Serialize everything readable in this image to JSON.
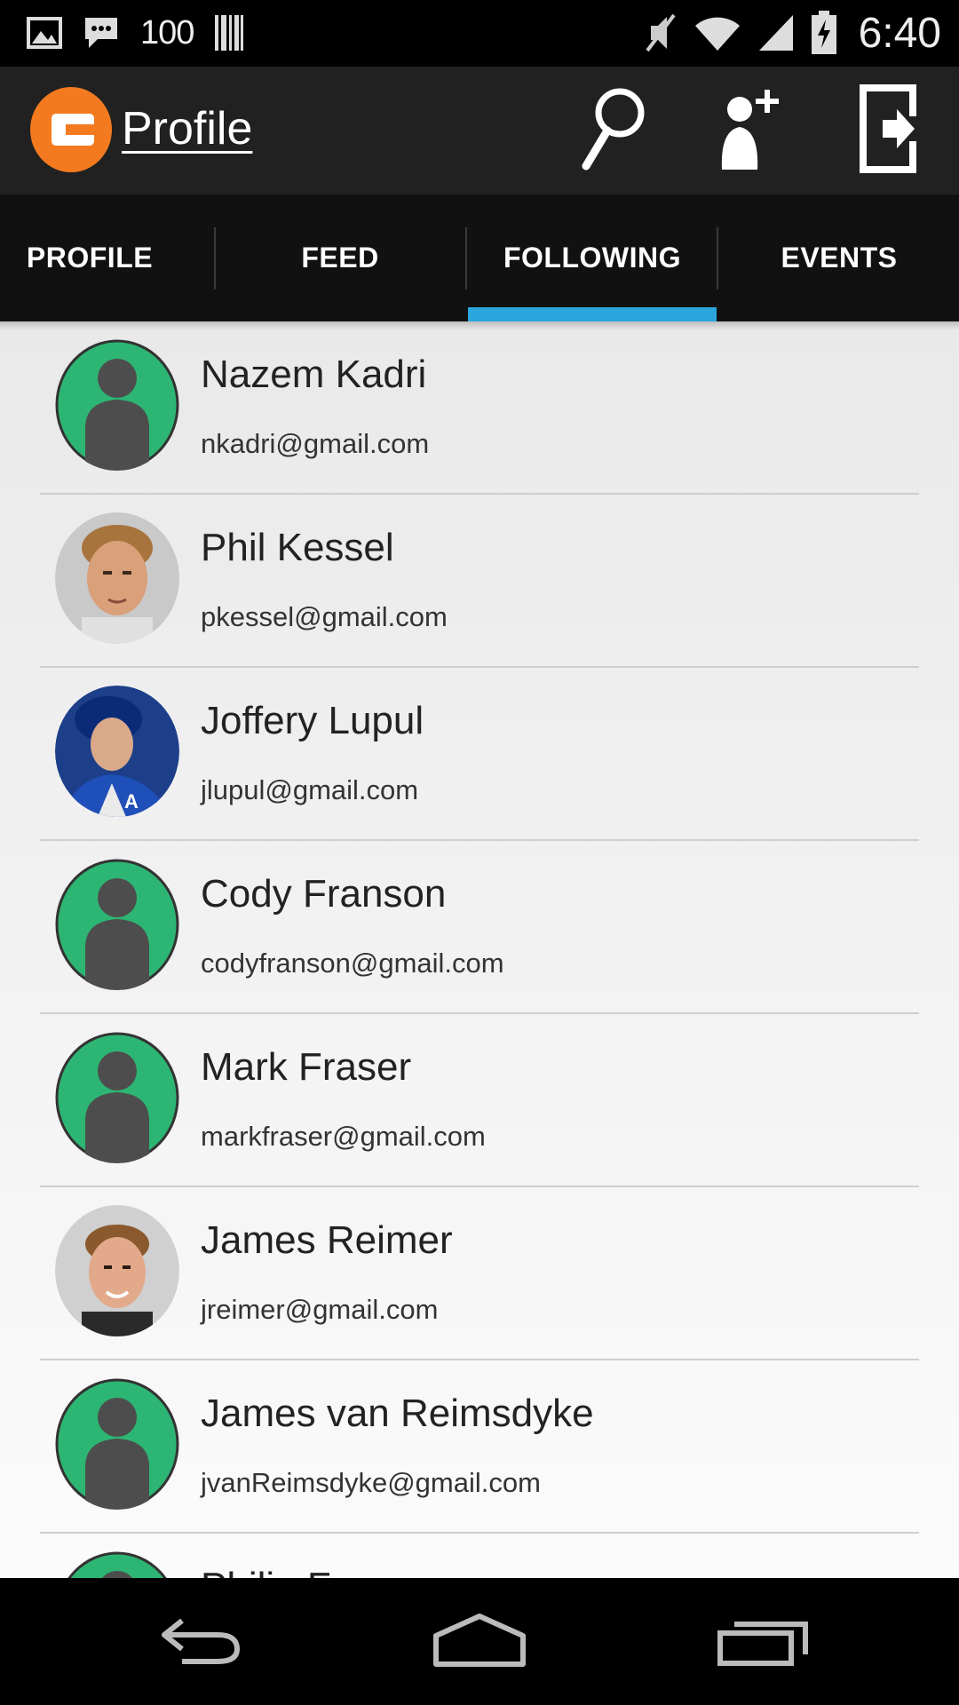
{
  "status_bar": {
    "icons_left": [
      "image-icon",
      "chat-icon",
      "barcode-icon"
    ],
    "battery_level_text": "100",
    "icons_right": [
      "mute-icon",
      "wifi-icon",
      "signal-icon",
      "battery-charging-icon"
    ],
    "time": "6:40"
  },
  "action_bar": {
    "title": "Profile",
    "logo": "app-logo-icon",
    "actions": [
      {
        "name": "search",
        "icon": "search-icon"
      },
      {
        "name": "add-user",
        "icon": "add-user-icon"
      },
      {
        "name": "logout",
        "icon": "logout-icon"
      }
    ]
  },
  "tabs": [
    {
      "label": "PROFILE",
      "selected": false
    },
    {
      "label": "FEED",
      "selected": false
    },
    {
      "label": "FOLLOWING",
      "selected": true
    },
    {
      "label": "EVENTS",
      "selected": false
    }
  ],
  "following": [
    {
      "name": "Nazem Kadri",
      "email": "nkadri@gmail.com",
      "avatar": "placeholder"
    },
    {
      "name": "Phil Kessel",
      "email": "pkessel@gmail.com",
      "avatar": "photo"
    },
    {
      "name": "Joffery Lupul",
      "email": "jlupul@gmail.com",
      "avatar": "photo-jersey"
    },
    {
      "name": "Cody Franson",
      "email": "codyfranson@gmail.com",
      "avatar": "placeholder"
    },
    {
      "name": "Mark Fraser",
      "email": "markfraser@gmail.com",
      "avatar": "placeholder"
    },
    {
      "name": "James Reimer",
      "email": "jreimer@gmail.com",
      "avatar": "photo"
    },
    {
      "name": "James van Reimsdyke",
      "email": "jvanReimsdyke@gmail.com",
      "avatar": "placeholder"
    },
    {
      "name": "Philip F",
      "email": "",
      "avatar": "placeholder"
    }
  ],
  "nav_bar": {
    "buttons": [
      "back-icon",
      "home-icon",
      "recents-icon"
    ]
  },
  "colors": {
    "action_bar": "#212121",
    "tab_bar": "#111111",
    "tab_indicator": "#2aa6dd",
    "avatar_placeholder": "#2db673",
    "logo": "#f47a20"
  }
}
